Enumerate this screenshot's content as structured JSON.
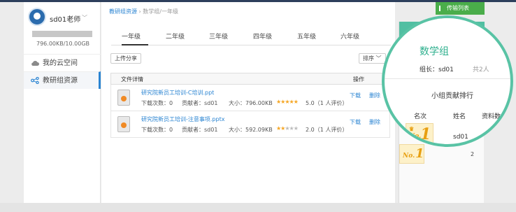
{
  "sidebar": {
    "username": "sd01老师",
    "quota": "796.00KB/10.00GB",
    "nav": [
      {
        "label": "我的云空间"
      },
      {
        "label": "教研组资源"
      }
    ]
  },
  "breadcrumb": {
    "root": "教研组资源",
    "separator": " › ",
    "current": "数学组/一年级"
  },
  "tabs": [
    "一年级",
    "二年级",
    "三年级",
    "四年级",
    "五年级",
    "六年级"
  ],
  "toolbar": {
    "upload_label": "上传分享",
    "sort_label": "排序"
  },
  "table": {
    "col_details": "文件详情",
    "col_actions": "操作",
    "rows": [
      {
        "name": "研究院新员工培训-C培训.ppt",
        "downloads": "下载次数：0",
        "contributor": "贡献者：sd01",
        "size": "大小：796.00KB",
        "stars_on": "★★★★★",
        "stars_off": "",
        "rating": "5.0（1 人评价）",
        "download": "下载",
        "delete": "删除"
      },
      {
        "name": "研究院新员工培训-注意事项.pptx",
        "downloads": "下载次数：0",
        "contributor": "贡献者：sd01",
        "size": "大小：592.09KB",
        "stars_on": "★★",
        "stars_off": "★★★",
        "rating": "2.0（1 人评价）",
        "download": "下载",
        "delete": "删除"
      }
    ]
  },
  "transfer_list": "传输列表",
  "group_panel": {
    "title": "数学组",
    "leader": "组长：sd01",
    "member_count": "共2人",
    "ranking_title": "小组贡献排行",
    "columns": [
      "名次",
      "姓名",
      "资料数"
    ],
    "rows": [
      {
        "rank_prefix": "No.",
        "rank": "1",
        "name": "sd01",
        "count": "2"
      }
    ]
  },
  "colors": {
    "accent_blue": "#2a84d2",
    "group_green": "#51bfa2",
    "transfer_green": "#4aad4a",
    "star": "#f5a623"
  }
}
